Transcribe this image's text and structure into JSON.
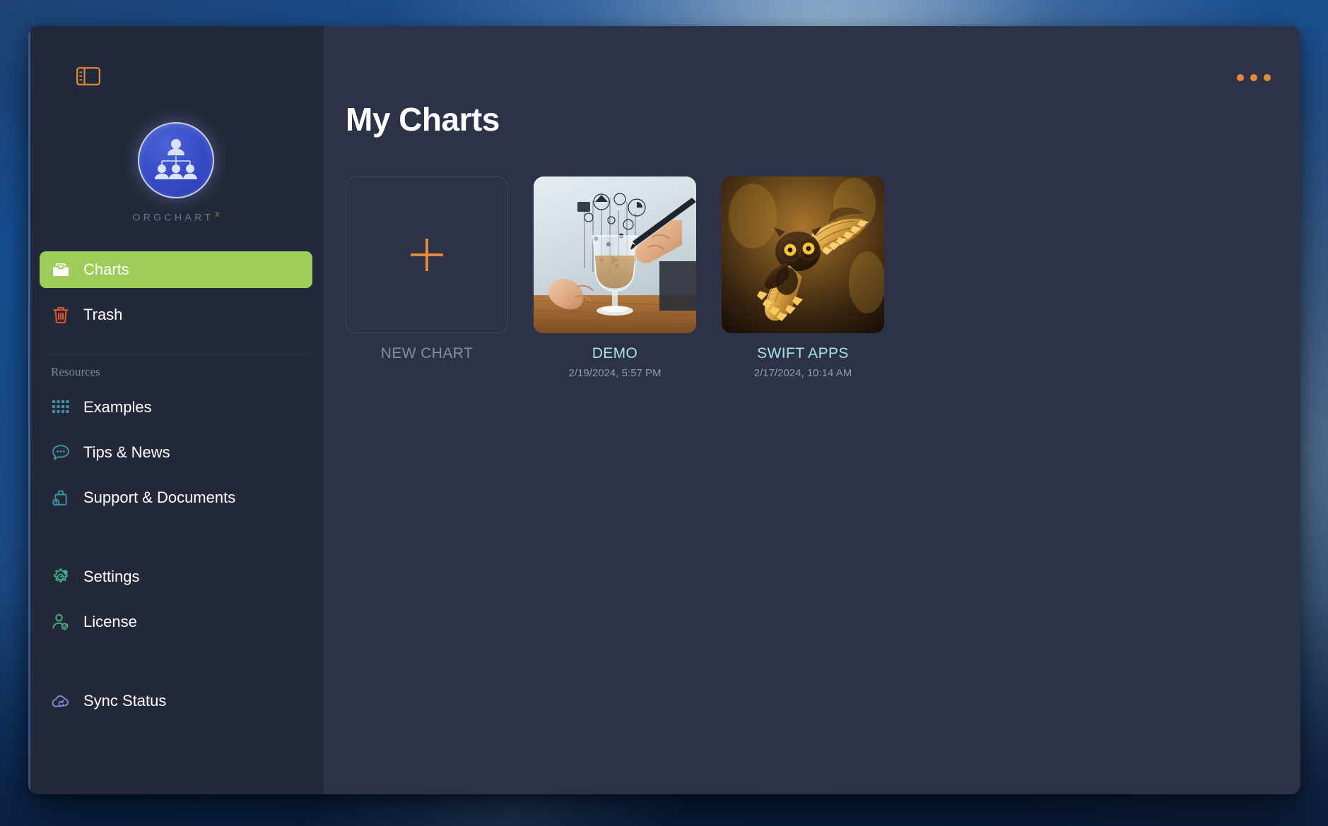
{
  "window": {
    "sidebar_toggle_icon": "sidebar-toggle-icon",
    "more_menu_icon": "ellipsis-icon"
  },
  "brand": {
    "name": "ORGCHART",
    "superscript": "X",
    "logo_icon": "org-chart-logo-icon"
  },
  "sidebar": {
    "primary_items": [
      {
        "label": "Charts",
        "icon": "inbox-tray-icon",
        "active": true
      },
      {
        "label": "Trash",
        "icon": "trash-can-icon",
        "active": false
      }
    ],
    "resources_label": "Resources",
    "resource_items": [
      {
        "label": "Examples",
        "icon": "grid-dots-icon"
      },
      {
        "label": "Tips & News",
        "icon": "speech-bubble-icon"
      },
      {
        "label": "Support & Documents",
        "icon": "help-briefcase-icon"
      }
    ],
    "system_items": [
      {
        "label": "Settings",
        "icon": "gear-icon"
      },
      {
        "label": "License",
        "icon": "user-check-icon"
      }
    ],
    "footer_items": [
      {
        "label": "Sync Status",
        "icon": "cloud-sync-icon"
      }
    ]
  },
  "main": {
    "title": "My Charts",
    "cards": [
      {
        "title": "NEW CHART",
        "date": "",
        "kind": "new",
        "thumb": "plus-icon"
      },
      {
        "title": "DEMO",
        "date": "2/19/2024, 5:57 PM",
        "kind": "chart",
        "thumb": "hands-drawing-glass-diagram-image"
      },
      {
        "title": "SWIFT APPS",
        "date": "2/17/2024, 10:14 AM",
        "kind": "chart",
        "thumb": "flying-owl-image"
      }
    ]
  },
  "colors": {
    "accent_orange": "#e08c3a",
    "active_green": "#9dcc5a",
    "link_cyan": "#a8e2ee",
    "trash_red": "#e0562a",
    "teal_icon": "#3e93a8",
    "settings_green": "#3fae8a",
    "license_green": "#4fae86",
    "sync_purple": "#8b86d8",
    "window_bg": "#262b3e",
    "sidebar_bg": "#242939",
    "main_bg": "#2d3246"
  }
}
